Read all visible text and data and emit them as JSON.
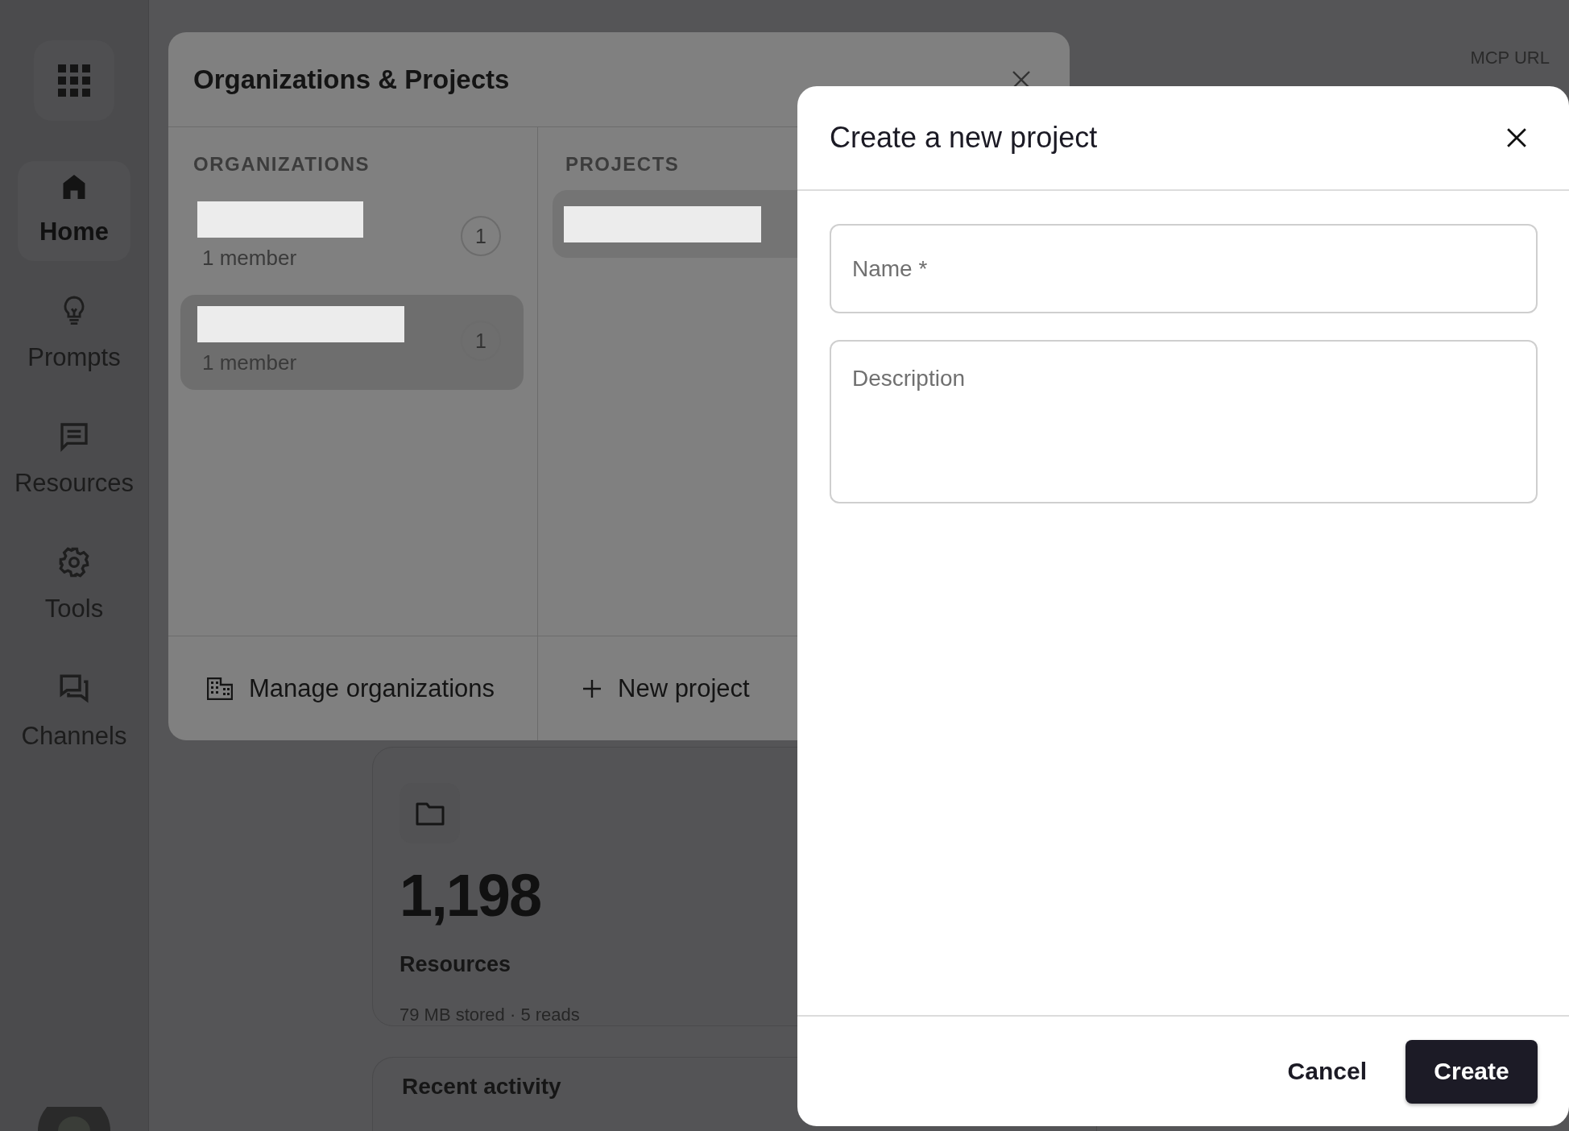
{
  "sidebar": {
    "apps_button": {
      "kind": "apps"
    },
    "items": [
      {
        "label": "Home",
        "selected": true
      },
      {
        "label": "Prompts",
        "selected": false
      },
      {
        "label": "Resources",
        "selected": false
      },
      {
        "label": "Tools",
        "selected": false
      },
      {
        "label": "Channels",
        "selected": false
      }
    ]
  },
  "header": {
    "mcp_label": "MCP URL"
  },
  "stats_card": {
    "value": "1,198",
    "label": "Resources",
    "detail": "79 MB stored · 5 reads"
  },
  "recent_activity": {
    "title": "Recent activity"
  },
  "org_dialog": {
    "title": "Organizations & Projects",
    "organizations_heading": "ORGANIZATIONS",
    "organizations": [
      {
        "members": "1 member",
        "count": "1",
        "selected": false
      },
      {
        "members": "1 member",
        "count": "1",
        "selected": true
      }
    ],
    "projects_heading": "PROJECTS",
    "projects": [
      {
        "selected": true
      }
    ],
    "manage_button": "Manage organizations",
    "new_project_button": "New project"
  },
  "create_dialog": {
    "title": "Create a new project",
    "fields": [
      {
        "placeholder": "Name *",
        "kind": "single"
      },
      {
        "placeholder": "Description",
        "kind": "multi"
      }
    ],
    "cancel": "Cancel",
    "submit": "Create"
  }
}
